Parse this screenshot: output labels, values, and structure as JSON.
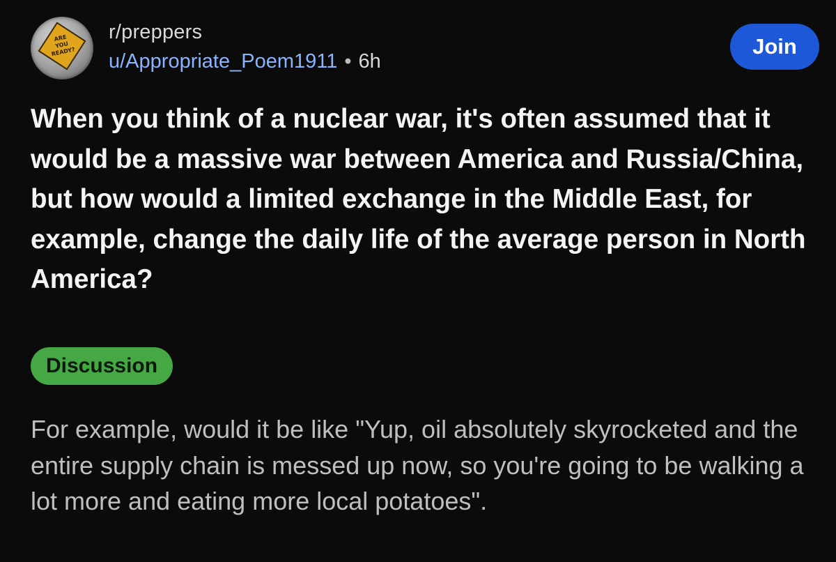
{
  "header": {
    "subreddit": "r/preppers",
    "username": "u/Appropriate_Poem1911",
    "separator": "•",
    "age": "6h",
    "avatar_text": "ARE YOU READY?",
    "join_label": "Join"
  },
  "post": {
    "title": "When you think of a nuclear war, it's often assumed that it would be a massive war between America and Russia/China, but how would a limited exchange in the Middle East, for example, change the daily life of the average person in North America?",
    "flair": "Discussion",
    "body": "For example, would it be like \"Yup, oil absolutely skyrocketed and the entire supply chain is messed up now, so you're going to be walking a lot more and eating more local potatoes\"."
  },
  "colors": {
    "background": "#0b0b0c",
    "join_button": "#1d58d8",
    "flair": "#46a844",
    "username": "#8ab4ff"
  }
}
